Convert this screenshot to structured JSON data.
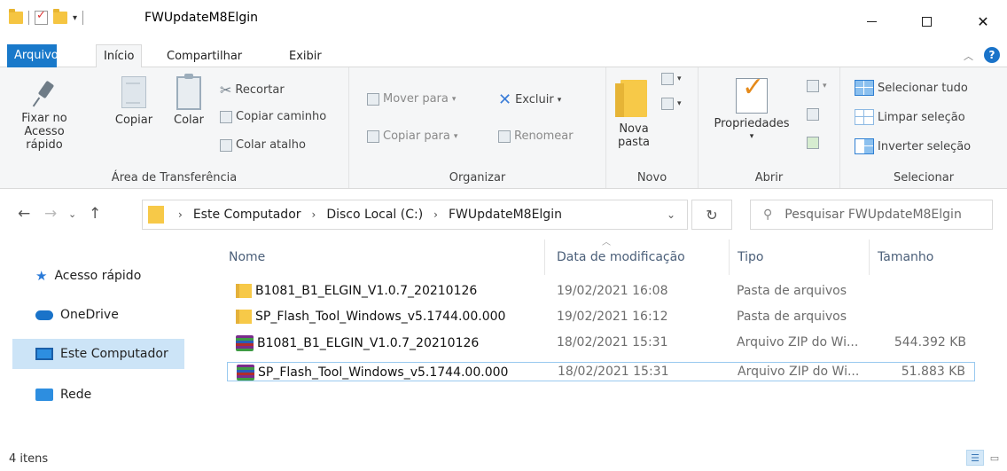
{
  "window": {
    "title": "FWUpdateM8Elgin"
  },
  "tabs": [
    {
      "label": "Arquivo"
    },
    {
      "label": "Início"
    },
    {
      "label": "Compartilhar"
    },
    {
      "label": "Exibir"
    }
  ],
  "ribbon": {
    "clipboard": {
      "pin_label_1": "Fixar no",
      "pin_label_2": "Acesso rápido",
      "copy_label": "Copiar",
      "paste_label": "Colar",
      "cut_label": "Recortar",
      "copy_path_label": "Copiar caminho",
      "paste_shortcut_label": "Colar atalho",
      "group_label": "Área de Transferência"
    },
    "organize": {
      "move_to_label": "Mover para",
      "copy_to_label": "Copiar para",
      "delete_label": "Excluir",
      "rename_label": "Renomear",
      "group_label": "Organizar"
    },
    "new": {
      "new_folder_label_1": "Nova",
      "new_folder_label_2": "pasta",
      "group_label": "Novo"
    },
    "open": {
      "properties_label": "Propriedades",
      "group_label": "Abrir"
    },
    "select": {
      "select_all_label": "Selecionar tudo",
      "clear_selection_label": "Limpar seleção",
      "invert_selection_label": "Inverter seleção",
      "group_label": "Selecionar"
    }
  },
  "address": {
    "breadcrumbs": [
      "Este Computador",
      "Disco Local (C:)",
      "FWUpdateM8Elgin"
    ],
    "search_placeholder": "Pesquisar FWUpdateM8Elgin"
  },
  "sidebar": {
    "items": [
      {
        "label": "Acesso rápido",
        "icon": "star-icon"
      },
      {
        "label": "OneDrive",
        "icon": "cloud-icon"
      },
      {
        "label": "Este Computador",
        "icon": "computer-icon",
        "selected": true
      },
      {
        "label": "Rede",
        "icon": "network-icon"
      }
    ]
  },
  "file_list": {
    "columns": [
      "Nome",
      "Data de modificação",
      "Tipo",
      "Tamanho"
    ],
    "rows": [
      {
        "name": "B1081_B1_ELGIN_V1.0.7_20210126",
        "date": "19/02/2021 16:08",
        "type": "Pasta de arquivos",
        "size": "",
        "icon": "folder-icon"
      },
      {
        "name": "SP_Flash_Tool_Windows_v5.1744.00.000",
        "date": "19/02/2021 16:12",
        "type": "Pasta de arquivos",
        "size": "",
        "icon": "folder-icon"
      },
      {
        "name": "B1081_B1_ELGIN_V1.0.7_20210126",
        "date": "18/02/2021 15:31",
        "type": "Arquivo ZIP do Wi...",
        "size": "544.392 KB",
        "icon": "zip-icon"
      },
      {
        "name": "SP_Flash_Tool_Windows_v5.1744.00.000",
        "date": "18/02/2021 15:31",
        "type": "Arquivo ZIP do Wi...",
        "size": "51.883 KB",
        "icon": "zip-icon"
      }
    ]
  },
  "status": {
    "item_count": "4 itens"
  },
  "colors": {
    "accent": "#1979ca",
    "selection": "#cce4f7",
    "folder": "#f7c948"
  }
}
